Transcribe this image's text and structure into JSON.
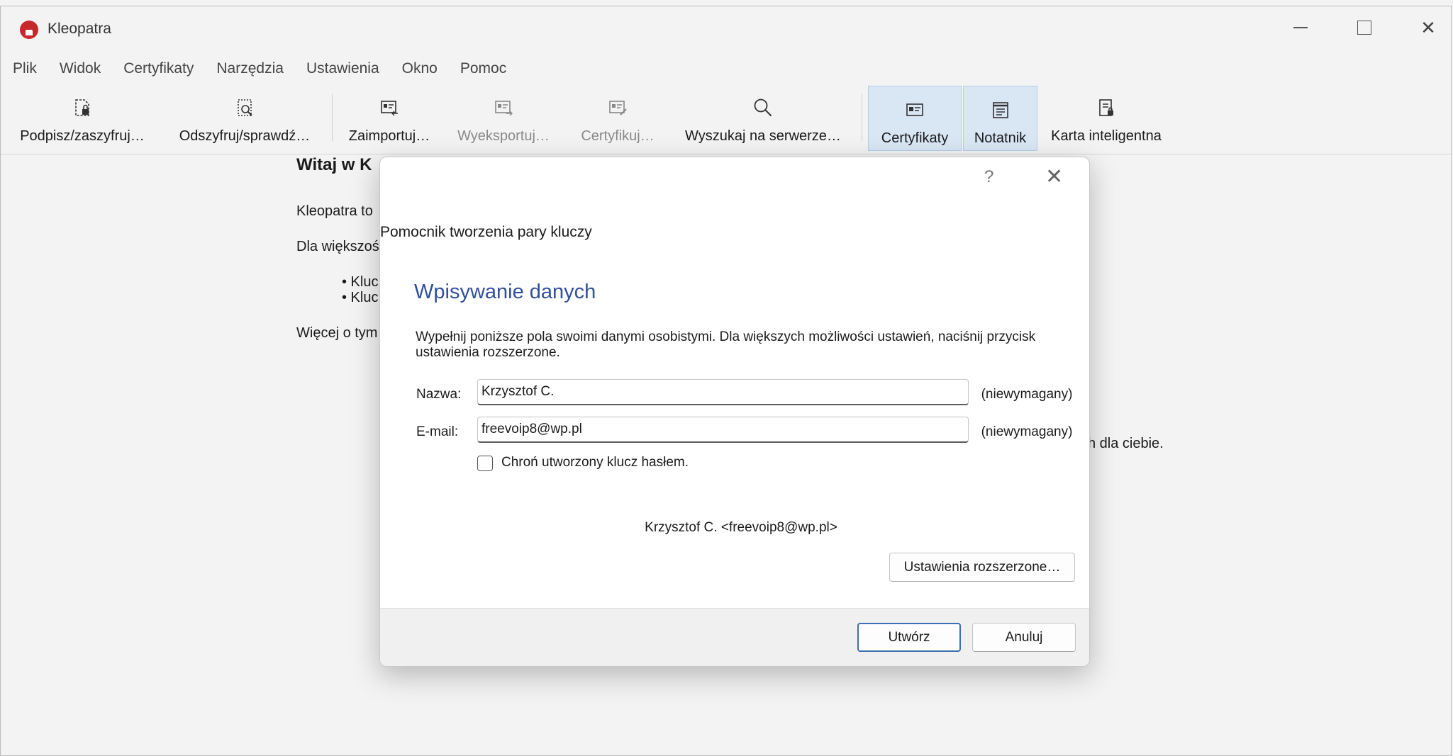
{
  "window": {
    "title": "Kleopatra",
    "app_icon": "kleopatra-logo-icon",
    "controls": [
      "minimize-icon",
      "maximize-icon",
      "close-icon"
    ]
  },
  "menu": [
    "Plik",
    "Widok",
    "Certyfikaty",
    "Narzędzia",
    "Ustawienia",
    "Okno",
    "Pomoc"
  ],
  "toolbar": {
    "sign_encrypt": "Podpisz/zaszyfruj…",
    "decrypt_verify": "Odszyfruj/sprawdź…",
    "import": "Zaimportuj…",
    "export": "Wyeksportuj…",
    "certify": "Certyfikuj…",
    "lookup": "Wyszukaj na serwerze…",
    "certificates": "Certyfikaty",
    "notepad": "Notatnik",
    "smartcard": "Karta inteligentna"
  },
  "welcome": {
    "title": "Witaj w K",
    "line1": "Kleopatra to",
    "line2": "Dla większośc",
    "bullet1": "• Kluc",
    "bullet2": "• Kluc",
    "line3": "Więcej o tym",
    "trailing": "h dla ciebie."
  },
  "dialog": {
    "help": "?",
    "heading": "Pomocnik tworzenia pary kluczy",
    "section_title": "Wpisywanie danych",
    "description": "Wypełnij poniższe pola swoimi danymi osobistymi. Dla większych możliwości ustawień, naciśnij przycisk ustawienia rozszerzone.",
    "name_label": "Nazwa:",
    "name_value": "Krzysztof C.",
    "email_label": "E-mail:",
    "email_value": "freevoip8@wp.pl",
    "optional_note": "(niewymagany)",
    "protect_label": "Chroń utworzony klucz hasłem.",
    "protect_checked": false,
    "preview": "Krzysztof C. <freevoip8@wp.pl>",
    "advanced_button": "Ustawienia rozszerzone…",
    "create_button": "Utwórz",
    "cancel_button": "Anuluj"
  },
  "colors": {
    "accent_heading": "#2f4f9f",
    "active_toolbar": "#d9e6f4",
    "brand_red": "#c6282b",
    "primary_button_border": "#3b6fb6"
  }
}
